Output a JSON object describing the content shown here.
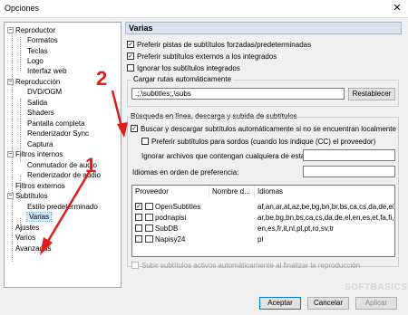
{
  "window": {
    "title": "Opciones",
    "close_glyph": "✕"
  },
  "tree": [
    {
      "label": "Reproductor",
      "level": 0,
      "expanded": true
    },
    {
      "label": "Formatos",
      "level": 1
    },
    {
      "label": "Teclas",
      "level": 1
    },
    {
      "label": "Logo",
      "level": 1
    },
    {
      "label": "Interfaz web",
      "level": 1
    },
    {
      "label": "Reproducción",
      "level": 0,
      "expanded": true
    },
    {
      "label": "DVD/OGM",
      "level": 1
    },
    {
      "label": "Salida",
      "level": 1
    },
    {
      "label": "Shaders",
      "level": 1
    },
    {
      "label": "Pantalla completa",
      "level": 1
    },
    {
      "label": "Renderizador Sync",
      "level": 1
    },
    {
      "label": "Captura",
      "level": 1
    },
    {
      "label": "Filtros internos",
      "level": 0,
      "expanded": true
    },
    {
      "label": "Conmutador de audio",
      "level": 1
    },
    {
      "label": "Renderizador de audio",
      "level": 1
    },
    {
      "label": "Filtros externos",
      "level": 0
    },
    {
      "label": "Subtítulos",
      "level": 0,
      "expanded": true
    },
    {
      "label": "Estilo predeterminado",
      "level": 1
    },
    {
      "label": "Varias",
      "level": 1,
      "selected": true
    },
    {
      "label": "Ajustes",
      "level": 0
    },
    {
      "label": "Varios",
      "level": 0
    },
    {
      "label": "Avanzadas",
      "level": 0
    }
  ],
  "panel": {
    "title": "Varias",
    "opt_forced": "Preferir pistas de subtítulos forzadas/predeterminadas",
    "opt_external": "Preferir subtítulos externos a los integrados",
    "opt_ignore_embedded": "Ignorar los subtítulos integrados",
    "autoload_group": "Cargar rutas automáticamente",
    "autoload_value": ".;.\\subtitles;.\\subs",
    "reset_button": "Restablecer",
    "search_group": "Búsqueda en línea, descarga y subida de subtítulos",
    "opt_auto_search": "Buscar y descargar subtítulos automáticamente si no se encuentran localmente",
    "opt_hearing_impaired": "Preferir subtítulos para sordos (cuando los indique (CC) el proveedor)",
    "ignore_files_label": "Ignorar archivos que contengan cualquiera de estas",
    "ignore_files_value": "",
    "languages_label": "Idiomas en orden de preferencia:",
    "languages_value": "",
    "columns": [
      "Proveedor",
      "Nombre d...",
      "Idiomas"
    ],
    "providers": [
      {
        "name": "OpenSubtitles",
        "checked": true,
        "languages": "af,an,ar,at,az,be,bg,bn,br,bs,ca,cs,da,de,el,e"
      },
      {
        "name": "podnapisi",
        "checked": false,
        "languages": "ar,be,bg,bn,bs,ca,cs,da,de,el,en,es,et,fa,fi,fr,"
      },
      {
        "name": "SubDB",
        "checked": false,
        "languages": "en,es,fr,it,nl,pl,pt,ro,sv,tr"
      },
      {
        "name": "Napisy24",
        "checked": false,
        "languages": "pl"
      }
    ],
    "opt_upload": "Subir subtítulos activos automáticamente al finalizar la reproducción",
    "accept_button": "Aceptar",
    "cancel_button": "Cancelar",
    "apply_button": "Aplicar"
  },
  "annotations": {
    "label_1": "1",
    "label_2": "2",
    "color": "#e01b1b"
  },
  "watermark": "SOFTBASICS"
}
